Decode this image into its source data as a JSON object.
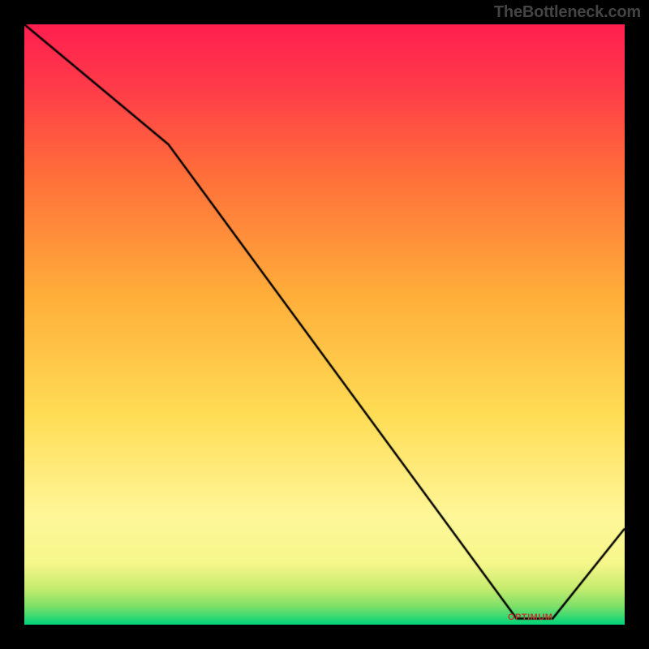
{
  "attribution": "TheBottleneck.com",
  "optimum_label": "OPTIMUM",
  "colors": {
    "frame": "#000000",
    "line": "#000000",
    "attribution_text": "#444444",
    "optimum_text": "#c0392b"
  },
  "chart_data": {
    "type": "line",
    "title": "",
    "xlabel": "",
    "ylabel": "",
    "xlim": [
      0,
      100
    ],
    "ylim": [
      0,
      100
    ],
    "x": [
      0,
      24,
      82,
      88,
      100
    ],
    "values": [
      100,
      80,
      1,
      1,
      16
    ],
    "optimum_x_range": [
      82,
      88
    ],
    "gradient_stops": [
      {
        "pos": 0.0,
        "color": "#00d47a"
      },
      {
        "pos": 0.03,
        "color": "#7de06a"
      },
      {
        "pos": 0.06,
        "color": "#c5ec6e"
      },
      {
        "pos": 0.1,
        "color": "#f5f78a"
      },
      {
        "pos": 0.18,
        "color": "#fff79a"
      },
      {
        "pos": 0.35,
        "color": "#ffdd55"
      },
      {
        "pos": 0.55,
        "color": "#ffae3a"
      },
      {
        "pos": 0.75,
        "color": "#ff6f3a"
      },
      {
        "pos": 0.9,
        "color": "#ff3a4a"
      },
      {
        "pos": 1.0,
        "color": "#ff1f4f"
      }
    ]
  }
}
